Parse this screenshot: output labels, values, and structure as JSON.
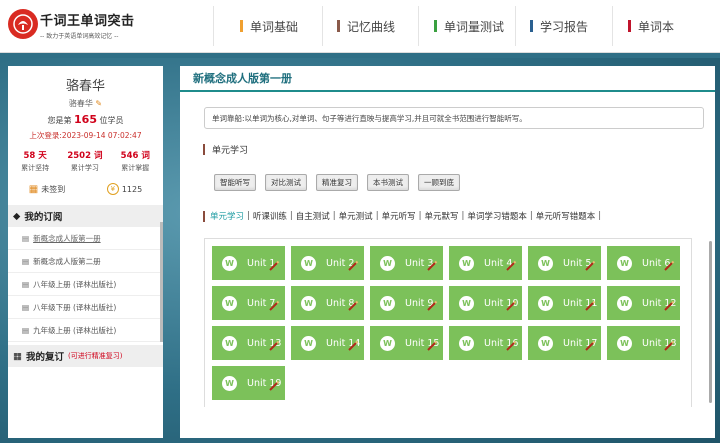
{
  "header": {
    "brand_title": "千词王单词突击",
    "brand_sub": "-- 致力于英语单词高效记忆 --",
    "nav": [
      {
        "label": "单词基础",
        "color": "#f0a030"
      },
      {
        "label": "记忆曲线",
        "color": "#8a5a4a"
      },
      {
        "label": "单词量测试",
        "color": "#3aa040"
      },
      {
        "label": "学习报告",
        "color": "#2a6090"
      },
      {
        "label": "单词本",
        "color": "#c0142c"
      }
    ]
  },
  "profile": {
    "name": "骆春华",
    "name_small": "骆春华",
    "rank_prefix": "您是第",
    "rank_number": "165",
    "rank_suffix": "位学员",
    "last_login": "上次登录:2023-09-14 07:02:47",
    "stats": [
      {
        "value": "58 天",
        "label": "累计坚持"
      },
      {
        "value": "2502 词",
        "label": "累计学习"
      },
      {
        "value": "546 词",
        "label": "累计掌握"
      }
    ],
    "checkin": "未签到",
    "coins": "1125"
  },
  "subscriptions": {
    "title": "我的订阅",
    "books": [
      "新概念成人版第一册",
      "新概念成人版第二册",
      "八年级上册 (译林出版社)",
      "八年级下册 (译林出版社)",
      "九年级上册 (译林出版社)"
    ]
  },
  "review": {
    "title": "我的复订",
    "tip": "(可进行精准复习)"
  },
  "main": {
    "title": "新概念成人版第一册",
    "intro": "单词靠船:以单词为核心,对单词、句子等进行直映与提高学习,并且可就全书范围进行智能听写。",
    "section_label": "单元学习",
    "buttons": [
      "智能听写",
      "对比测试",
      "精准复习",
      "本书测试",
      "一顾到底"
    ],
    "tabs": [
      "单元学习",
      "听课训练",
      "自主测试",
      "单元测试",
      "单元听写",
      "单元默写",
      "单词学习错题本",
      "单元听写错题本"
    ],
    "units": [
      "Unit 1",
      "Unit 2",
      "Unit 3",
      "Unit 4",
      "Unit 5",
      "Unit 6",
      "Unit 7",
      "Unit 8",
      "Unit 9",
      "Unit 10",
      "Unit 11",
      "Unit 12",
      "Unit 13",
      "Unit 14",
      "Unit 15",
      "Unit 16",
      "Unit 17",
      "Unit 18",
      "Unit 19"
    ]
  }
}
